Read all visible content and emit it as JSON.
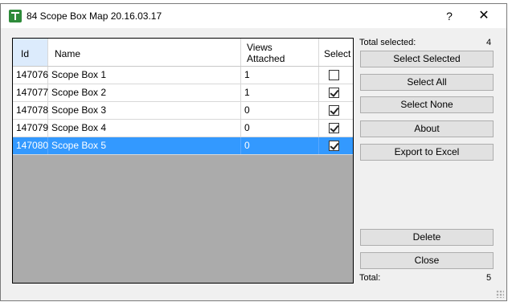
{
  "window": {
    "title": "84 Scope Box Map 20.16.03.17",
    "help_label": "?",
    "close_label": "✕"
  },
  "grid": {
    "columns": [
      "Id",
      "Name",
      "Views Attached",
      "Select"
    ],
    "rows": [
      {
        "id": "147076",
        "name": "Scope Box 1",
        "views": "1",
        "checked": false,
        "selected": false
      },
      {
        "id": "147077",
        "name": "Scope Box 2",
        "views": "1",
        "checked": true,
        "selected": false
      },
      {
        "id": "147078",
        "name": "Scope Box 3",
        "views": "0",
        "checked": true,
        "selected": false
      },
      {
        "id": "147079",
        "name": "Scope Box 4",
        "views": "0",
        "checked": true,
        "selected": false
      },
      {
        "id": "147080",
        "name": "Scope Box 5",
        "views": "0",
        "checked": true,
        "selected": true
      }
    ]
  },
  "side": {
    "total_selected_label": "Total selected:",
    "total_selected_value": "4",
    "buttons": {
      "select_selected": "Select Selected",
      "select_all": "Select All",
      "select_none": "Select None",
      "about": "About",
      "export": "Export to Excel",
      "delete": "Delete",
      "close": "Close"
    },
    "total_label": "Total:",
    "total_value": "5"
  },
  "colors": {
    "selection": "#3399ff",
    "grid_background": "#ababab",
    "button_face": "#e1e1e1"
  }
}
